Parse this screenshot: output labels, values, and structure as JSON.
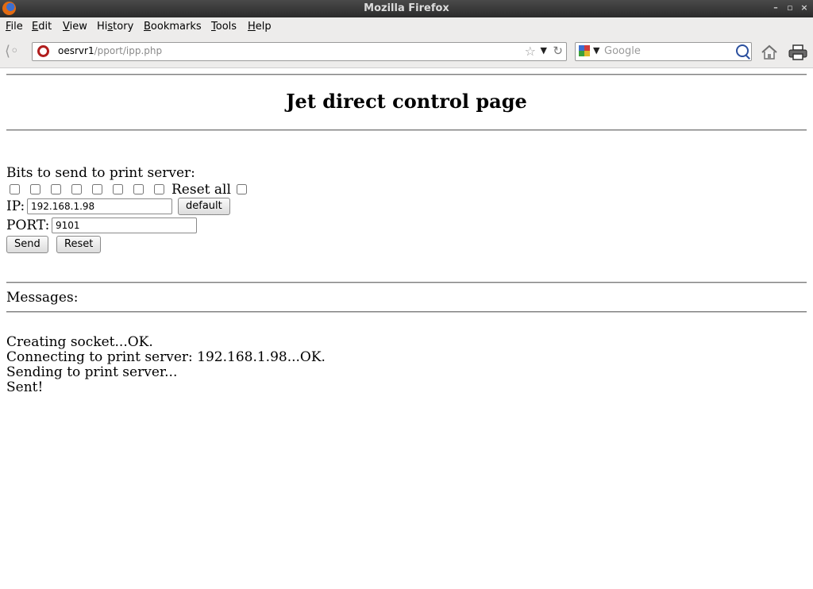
{
  "window": {
    "title": "Mozilla Firefox"
  },
  "menu": [
    {
      "pre": "",
      "key": "F",
      "post": "ile"
    },
    {
      "pre": "",
      "key": "E",
      "post": "dit"
    },
    {
      "pre": "",
      "key": "V",
      "post": "iew"
    },
    {
      "pre": "Hi",
      "key": "s",
      "post": "tory"
    },
    {
      "pre": "",
      "key": "B",
      "post": "ookmarks"
    },
    {
      "pre": "",
      "key": "T",
      "post": "ools"
    },
    {
      "pre": "",
      "key": "H",
      "post": "elp"
    }
  ],
  "urlbar": {
    "host": "oesrvr1",
    "path": "/pport/ipp.php"
  },
  "search": {
    "placeholder": "Google",
    "value": ""
  },
  "icons": {
    "back": "back-arrow-icon",
    "star": "bookmark-star-icon",
    "reload": "reload-icon",
    "home": "home-icon",
    "print": "print-icon",
    "search": "magnifier-icon"
  },
  "page": {
    "title": "Jet direct control page",
    "bits_label": "Bits to send to print server:",
    "bits_count": 8,
    "reset_all_label": "Reset all",
    "ip_label": "IP:",
    "ip_value": "192.168.1.98",
    "default_button": "default",
    "port_label": "PORT:",
    "port_value": "9101",
    "send_button": "Send",
    "reset_button": "Reset",
    "messages_label": "Messages:",
    "messages": [
      "Creating socket...OK.",
      "Connecting to print server: 192.168.1.98...OK.",
      "Sending to print server...",
      "Sent!"
    ]
  },
  "colors": {
    "titlebar": "#2b2b2b",
    "chrome": "#edeceb",
    "site_icon": "#b11e1e",
    "search_icon": "#2a4f9e"
  }
}
